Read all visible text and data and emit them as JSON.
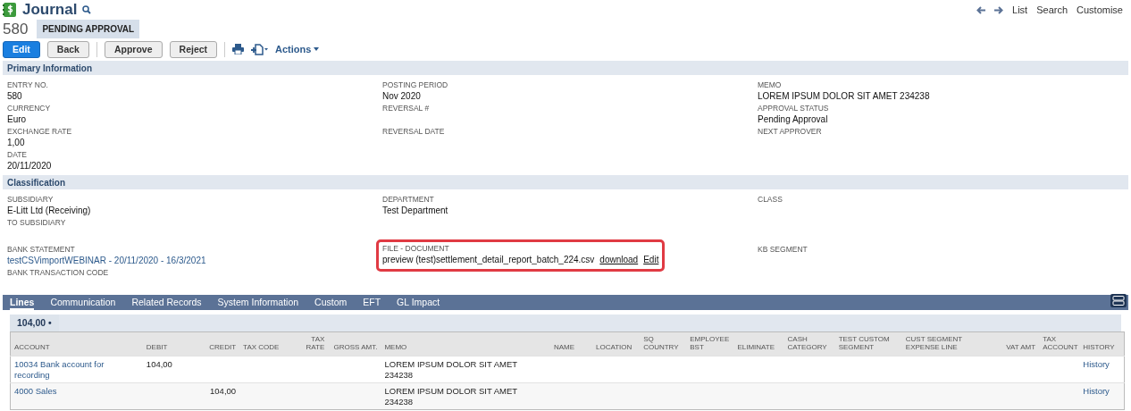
{
  "header": {
    "title": "Journal",
    "number": "580",
    "status": "PENDING APPROVAL",
    "nav": [
      "List",
      "Search",
      "Customise"
    ]
  },
  "toolbar": {
    "buttons": [
      {
        "label": "Edit",
        "kind": "primary"
      },
      {
        "label": "Back",
        "kind": "plain"
      },
      {
        "label": "Approve",
        "kind": "plain"
      },
      {
        "label": "Reject",
        "kind": "plain"
      }
    ],
    "actions": "Actions"
  },
  "sections": [
    {
      "title": "Primary Information",
      "groups": [
        [
          [
            {
              "label": "ENTRY NO.",
              "value": "580"
            },
            {
              "label": "CURRENCY",
              "value": "Euro"
            },
            {
              "label": "EXCHANGE RATE",
              "value": "1,00"
            },
            {
              "label": "DATE",
              "value": "20/11/2020"
            }
          ],
          [
            {
              "label": "POSTING PERIOD",
              "value": "Nov 2020"
            },
            {
              "label": "REVERSAL #"
            },
            {
              "label": "REVERSAL DATE"
            }
          ],
          [
            {
              "label": "MEMO",
              "value": "LOREM IPSUM DOLOR SIT AMET 234238"
            },
            {
              "label": "APPROVAL STATUS",
              "value": "Pending Approval"
            },
            {
              "label": "NEXT APPROVER"
            }
          ]
        ]
      ]
    },
    {
      "title": "Classification",
      "groups": [
        [
          [
            {
              "label": "SUBSIDIARY",
              "value": "E-Litt Ltd (Receiving)"
            },
            {
              "label": "TO SUBSIDIARY"
            }
          ],
          [
            {
              "label": "DEPARTMENT",
              "value": "Test Department"
            }
          ],
          [
            {
              "label": "CLASS"
            }
          ]
        ],
        [
          [
            {
              "label": "BANK STATEMENT",
              "value": "testCSVimportWEBINAR - 20/11/2020 - 16/3/2021",
              "kind": "link"
            },
            {
              "label": "BANK TRANSACTION CODE"
            }
          ],
          [
            {
              "label": "FILE - DOCUMENT",
              "value": "preview (test)settlement_detail_report_batch_224.csv",
              "kind": "file",
              "links": [
                "download",
                "Edit"
              ],
              "highlighted": true
            }
          ],
          [
            {
              "label": "KB SEGMENT"
            }
          ]
        ]
      ]
    }
  ],
  "tabs": [
    {
      "label": "Lines",
      "selected": true
    },
    {
      "label": "Communication",
      "selected": false
    },
    {
      "label": "Related Records",
      "selected": false
    },
    {
      "label": "System Information",
      "selected": false
    },
    {
      "label": "Custom",
      "selected": false
    },
    {
      "label": "EFT",
      "selected": false
    },
    {
      "label": "GL Impact",
      "selected": false
    }
  ],
  "subtab": {
    "label": "104,00 •"
  },
  "table": {
    "columns": [
      "ACCOUNT",
      "DEBIT",
      "CREDIT",
      "TAX CODE",
      "TAX RATE",
      "GROSS AMT.",
      "MEMO",
      "NAME",
      "LOCATION",
      "SQ COUNTRY",
      "EMPLOYEE BST",
      "ELIMINATE",
      "CASH CATEGORY",
      "TEST CUSTOM SEGMENT",
      "CUST SEGMENT EXPENSE LINE",
      "VAT AMT",
      "TAX ACCOUNT",
      "HISTORY"
    ],
    "rows": [
      {
        "cells": [
          "10034 Bank account for recording",
          "104,00",
          null,
          null,
          null,
          null,
          "LOREM IPSUM DOLOR SIT AMET 234238",
          null,
          null,
          null,
          null,
          null,
          null,
          null,
          null,
          null,
          null,
          "History"
        ]
      },
      {
        "cells": [
          "4000 Sales",
          null,
          "104,00",
          null,
          null,
          null,
          "LOREM IPSUM DOLOR SIT AMET 234238",
          null,
          null,
          null,
          null,
          null,
          null,
          null,
          null,
          null,
          null,
          "History"
        ]
      }
    ]
  }
}
